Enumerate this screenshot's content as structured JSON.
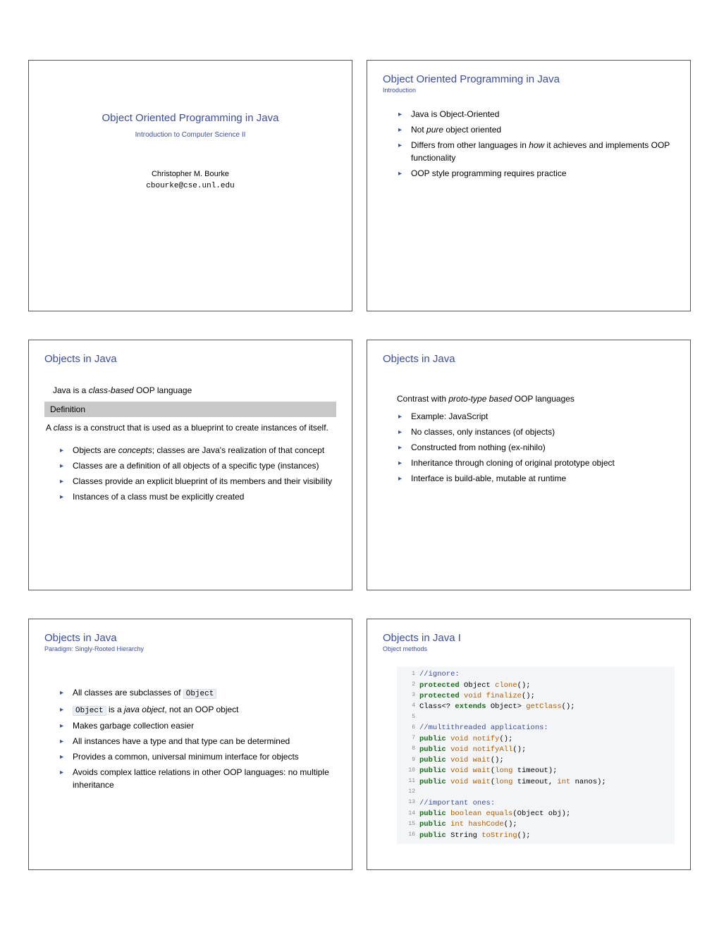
{
  "slides": [
    {
      "title": "Object Oriented Programming in Java",
      "subtitle": "Introduction to Computer Science II",
      "author_name": "Christopher M. Bourke",
      "author_email": "cbourke@cse.unl.edu"
    },
    {
      "title": "Object Oriented Programming in Java",
      "subtitle": "Introduction",
      "bullets": [
        "Java is Object-Oriented",
        "Not <em>pure</em> object oriented",
        "Differs from other languages in <em>how</em> it achieves and implements OOP functionality",
        "OOP style programming requires practice"
      ]
    },
    {
      "title": "Objects in Java",
      "intro": "Java is a <em>class-based</em> OOP language",
      "def_head": "Definition",
      "def_body": "A <em>class</em> is a construct that is used as a blueprint to create instances of itself.",
      "bullets": [
        "Objects are <em>concepts</em>; classes are Java's realization of that concept",
        "Classes are a definition of all objects of a specific type (instances)",
        "Classes provide an explicit blueprint of its members and their visibility",
        "Instances of a class must be explicitly created"
      ]
    },
    {
      "title": "Objects in Java",
      "intro": "Contrast with <em>proto-type based</em> OOP languages",
      "bullets": [
        "Example: JavaScript",
        "No classes, only instances (of objects)",
        "Constructed from nothing (ex-nihilo)",
        "Inheritance through cloning of original prototype object",
        "Interface is build-able, mutable at runtime"
      ]
    },
    {
      "title": "Objects in Java",
      "subtitle": "Paradigm: Singly-Rooted Hierarchy",
      "bullets": [
        "All classes are subclasses of <span class=\"code-inline\">Object</span>",
        "<span class=\"code-inline\">Object</span> is a <em>java object</em>, not an OOP object",
        "Makes garbage collection easier",
        "All instances have a type and that type can be determined",
        "Provides a common, universal minimum interface for objects",
        "Avoids complex lattice relations in other OOP languages: no multiple inheritance"
      ]
    },
    {
      "title": "Objects in Java I",
      "subtitle": "Object methods",
      "code": [
        {
          "n": 1,
          "h": "<span class=\"cmt\">//ignore:</span>"
        },
        {
          "n": 2,
          "h": "<span class=\"kw-mod\">protected</span> Object <span class=\"kw-type\">clone</span>();"
        },
        {
          "n": 3,
          "h": "<span class=\"kw-mod\">protected</span> <span class=\"kw-type\">void</span> <span class=\"kw-type\">finalize</span>();"
        },
        {
          "n": 4,
          "h": "Class&lt;? <span class=\"kw-mod\">extends</span> Object&gt; <span class=\"kw-type\">getClass</span>();"
        },
        {
          "n": 5,
          "h": ""
        },
        {
          "n": 6,
          "h": "<span class=\"cmt\">//multithreaded applications:</span>"
        },
        {
          "n": 7,
          "h": "<span class=\"kw-mod\">public</span> <span class=\"kw-type\">void</span> <span class=\"kw-type\">notify</span>();"
        },
        {
          "n": 8,
          "h": "<span class=\"kw-mod\">public</span> <span class=\"kw-type\">void</span> <span class=\"kw-type\">notifyAll</span>();"
        },
        {
          "n": 9,
          "h": "<span class=\"kw-mod\">public</span> <span class=\"kw-type\">void</span> <span class=\"kw-type\">wait</span>();"
        },
        {
          "n": 10,
          "h": "<span class=\"kw-mod\">public</span> <span class=\"kw-type\">void</span> <span class=\"kw-type\">wait</span>(<span class=\"kw-type\">long</span> timeout);"
        },
        {
          "n": 11,
          "h": "<span class=\"kw-mod\">public</span> <span class=\"kw-type\">void</span> <span class=\"kw-type\">wait</span>(<span class=\"kw-type\">long</span> timeout, <span class=\"kw-type\">int</span> nanos);"
        },
        {
          "n": 12,
          "h": ""
        },
        {
          "n": 13,
          "h": "<span class=\"cmt\">//important ones:</span>"
        },
        {
          "n": 14,
          "h": "<span class=\"kw-mod\">public</span> <span class=\"kw-type\">boolean</span> <span class=\"kw-type\">equals</span>(Object obj);"
        },
        {
          "n": 15,
          "h": "<span class=\"kw-mod\">public</span> <span class=\"kw-type\">int</span> <span class=\"kw-type\">hashCode</span>();"
        },
        {
          "n": 16,
          "h": "<span class=\"kw-mod\">public</span> String <span class=\"kw-type\">toString</span>();"
        }
      ]
    }
  ]
}
